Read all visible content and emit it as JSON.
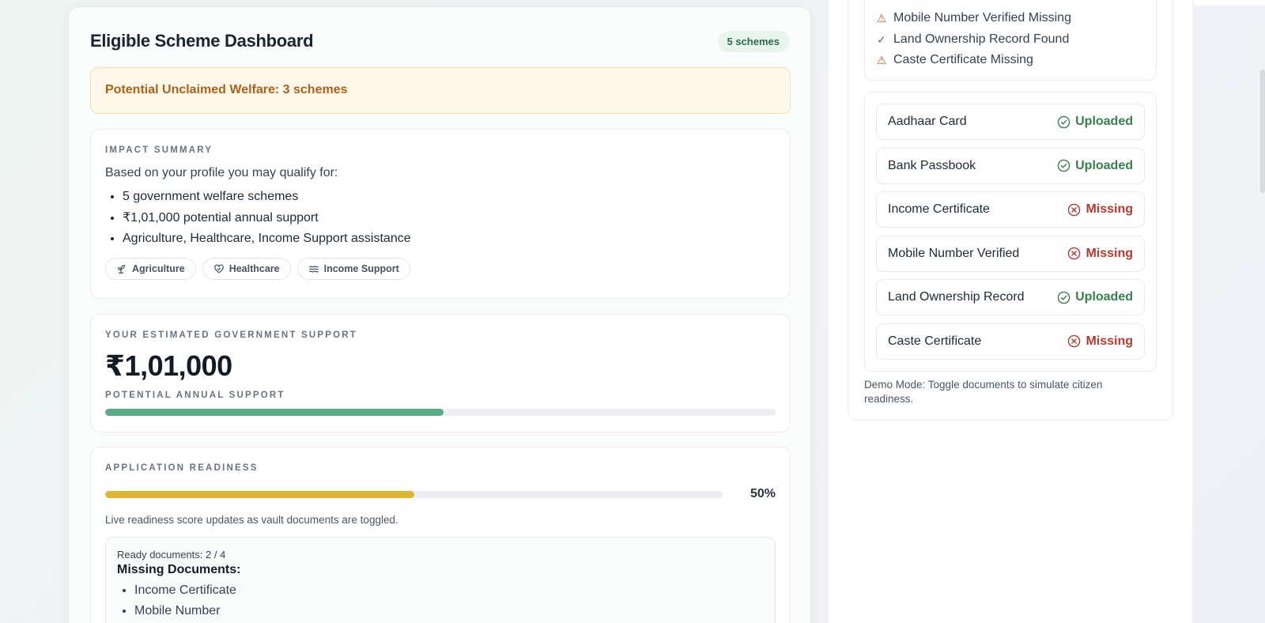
{
  "header": {
    "title": "Eligible Scheme Dashboard",
    "badge": "5 schemes"
  },
  "alert": {
    "text": "Potential Unclaimed Welfare: 3 schemes"
  },
  "impact": {
    "label": "IMPACT SUMMARY",
    "intro": "Based on your profile you may qualify for:",
    "items": [
      "5 government welfare schemes",
      "₹1,01,000 potential annual support",
      "Agriculture, Healthcare, Income Support assistance"
    ],
    "chips": [
      {
        "label": "Agriculture",
        "icon": "sprout-icon"
      },
      {
        "label": "Healthcare",
        "icon": "heart-hands-icon"
      },
      {
        "label": "Income Support",
        "icon": "waves-icon"
      }
    ]
  },
  "support": {
    "label": "YOUR ESTIMATED GOVERNMENT SUPPORT",
    "amount": "₹1,01,000",
    "sub_label": "POTENTIAL ANNUAL SUPPORT",
    "progress_fraction": 0.505
  },
  "readiness": {
    "label": "APPLICATION READINESS",
    "percent_text": "50%",
    "progress_fraction": 0.5,
    "note": "Live readiness score updates as vault documents are toggled.",
    "ready_count": "Ready documents: 2 / 4",
    "missing_title": "Missing Documents:",
    "missing_items": [
      "Income Certificate",
      "Mobile Number"
    ]
  },
  "status_list": [
    {
      "text": "Mobile Number Verified Missing",
      "icon": "warning-icon"
    },
    {
      "text": "Land Ownership Record Found",
      "icon": "check-icon"
    },
    {
      "text": "Caste Certificate Missing",
      "icon": "warning-icon"
    }
  ],
  "vault": {
    "documents": [
      {
        "name": "Aadhaar Card",
        "status": "Uploaded",
        "state": "uploaded"
      },
      {
        "name": "Bank Passbook",
        "status": "Uploaded",
        "state": "uploaded"
      },
      {
        "name": "Income Certificate",
        "status": "Missing",
        "state": "missing"
      },
      {
        "name": "Mobile Number Verified",
        "status": "Missing",
        "state": "missing"
      },
      {
        "name": "Land Ownership Record",
        "status": "Uploaded",
        "state": "uploaded"
      },
      {
        "name": "Caste Certificate",
        "status": "Missing",
        "state": "missing"
      }
    ],
    "demo_note": "Demo Mode: Toggle documents to simulate citizen readiness."
  },
  "colors": {
    "support_bar": "#5baa88",
    "readiness_bar": "#ddb637",
    "uploaded": "#3a7d4f",
    "missing": "#b23a30",
    "alert_text": "#a9621e"
  }
}
